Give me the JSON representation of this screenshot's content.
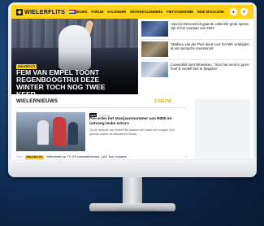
{
  "site": {
    "logo": "WIELERFLITS",
    "nav": [
      "NIEUWS",
      "FORUM",
      "KALENDER",
      "WATERKALENDERS",
      "FIETSTOERISME",
      "RIDE MAGAZINE"
    ]
  },
  "hero": {
    "tag": "WIELERFLITS",
    "title": "FEM VAN EMPEL TOONT REGENBOOGTRUI DEZE WINTER TOCH NOG TWEE KEER"
  },
  "side": [
    {
      "text": "Alpecin-Deceuninck gaat de collectief grote spelen zijn in het voorjaar van 2023"
    },
    {
      "text": "'Mathieu van der Poel deed voor het WK veldrijden al een tactische meesterzet'"
    },
    {
      "text": "Cavendish toert Wreeksen: \"Voor het eerst in jaren hoef ik meself niet te bewijzen\""
    }
  ],
  "news": {
    "title": "WIELERNIEUWS",
    "count": "2 NIEUW",
    "featured": {
      "badge": "RDS",
      "time": "17 minuten",
      "title": "Pre-order het Voorjaarsnummer van RIDE en ontvang leuke extra's",
      "desc": "Op de redactie van WielerFlits stakken we naast het voorjaar. Een periode waarin de klassiekers elkaar..."
    },
    "row": {
      "time": "16:50",
      "badge": "WIELERFLITS",
      "title": "Wielrennen op TV: EK baanwielrennen, UAE Tour vrouwen",
      "comments": "0"
    }
  },
  "colors": {
    "accent": "#ffd21a",
    "dark": "#111111"
  }
}
